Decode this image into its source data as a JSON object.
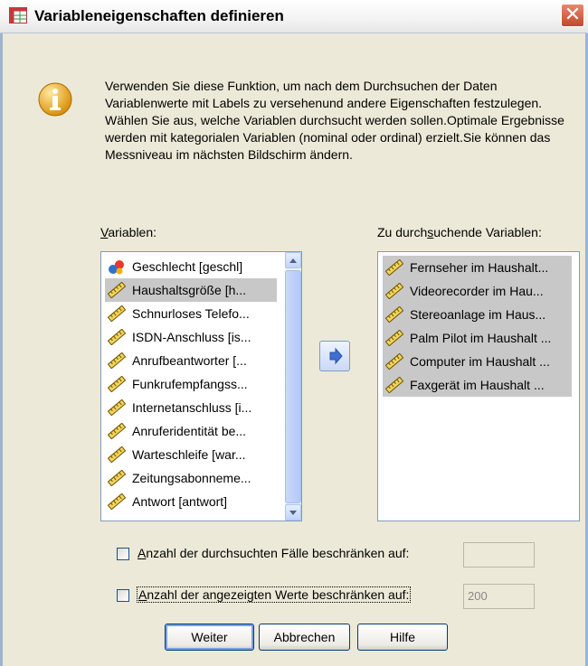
{
  "window": {
    "title": "Variableneigenschaften definieren",
    "close_glyph": "✕"
  },
  "info": {
    "icon": "info-icon",
    "text": "Verwenden Sie diese Funktion, um nach dem Durchsuchen der Daten Variablenwerte mit Labels zu versehenund andere Eigenschaften festzulegen. Wählen Sie aus, welche Variablen durchsucht werden sollen.Optimale Ergebnisse werden mit kategorialen Variablen (nominal oder ordinal) erzielt.Sie können das Messniveau im nächsten Bildschirm ändern."
  },
  "source": {
    "label_pre": "",
    "label_key": "V",
    "label_post": "ariablen:",
    "items": [
      {
        "label": "Geschlecht [geschl]",
        "icon": "nominal-variable-icon",
        "selected": false
      },
      {
        "label": "Haushaltsgröße [h...",
        "icon": "scale-variable-icon",
        "selected": true
      },
      {
        "label": "Schnurloses Telefo...",
        "icon": "scale-variable-icon",
        "selected": false
      },
      {
        "label": "ISDN-Anschluss [is...",
        "icon": "scale-variable-icon",
        "selected": false
      },
      {
        "label": "Anrufbeantworter [...",
        "icon": "scale-variable-icon",
        "selected": false
      },
      {
        "label": "Funkrufempfangss...",
        "icon": "scale-variable-icon",
        "selected": false
      },
      {
        "label": "Internetanschluss [i...",
        "icon": "scale-variable-icon",
        "selected": false
      },
      {
        "label": "Anruferidentität be...",
        "icon": "scale-variable-icon",
        "selected": false
      },
      {
        "label": "Warteschleife [war...",
        "icon": "scale-variable-icon",
        "selected": false
      },
      {
        "label": "Zeitungsabonneme...",
        "icon": "scale-variable-icon",
        "selected": false
      },
      {
        "label": "Antwort [antwort]",
        "icon": "scale-variable-icon",
        "selected": false
      }
    ]
  },
  "target": {
    "label_pre": "Zu durch",
    "label_key": "s",
    "label_post": "uchende Variablen:",
    "items": [
      {
        "label": "Fernseher im Haushalt...",
        "icon": "scale-variable-icon",
        "selected": true
      },
      {
        "label": "Videorecorder im Hau...",
        "icon": "scale-variable-icon",
        "selected": true
      },
      {
        "label": "Stereoanlage im Haus...",
        "icon": "scale-variable-icon",
        "selected": true
      },
      {
        "label": "Palm Pilot im Haushalt ...",
        "icon": "scale-variable-icon",
        "selected": true
      },
      {
        "label": "Computer im Haushalt ...",
        "icon": "scale-variable-icon",
        "selected": true
      },
      {
        "label": "Faxgerät im Haushalt ...",
        "icon": "scale-variable-icon",
        "selected": true
      }
    ]
  },
  "move_button": {
    "icon": "arrow-right-icon"
  },
  "options": {
    "limit_cases": {
      "label_key": "A",
      "label_rest": "nzahl der durchsuchten Fälle beschränken auf:",
      "checked": false,
      "value": ""
    },
    "limit_values": {
      "label_key": "A",
      "label_rest": "nzahl der angezeigten Werte beschränken auf:",
      "checked": false,
      "value": "200"
    }
  },
  "buttons": {
    "ok": "Weiter",
    "cancel": "Abbrechen",
    "help": "Hilfe"
  },
  "colors": {
    "dialog_bg": "#ece9d8",
    "selection": "#c8c8c8",
    "list_border": "#7f9db9",
    "button_border": "#003c74"
  }
}
